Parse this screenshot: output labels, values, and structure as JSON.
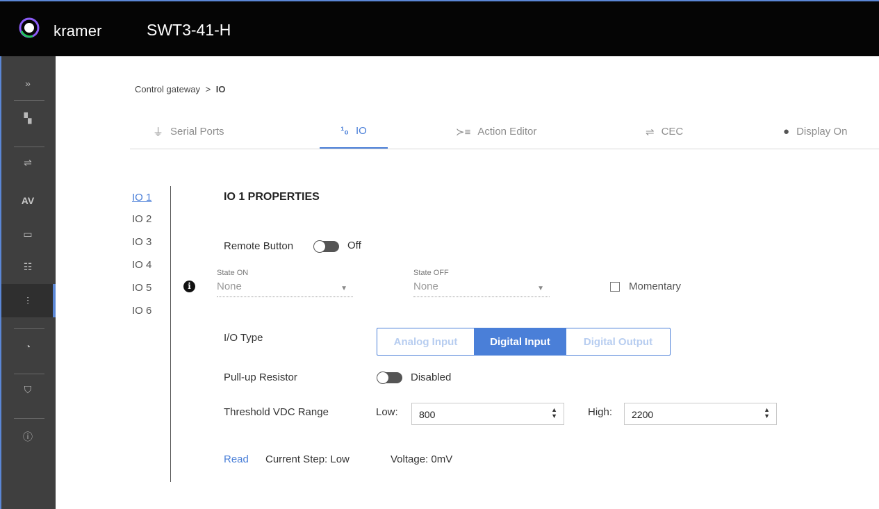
{
  "header": {
    "brand": "kramer",
    "model": "SWT3-41-H"
  },
  "sidebar": {
    "items": [
      {
        "icon": "expand-icon",
        "glyph": "»"
      },
      {
        "icon": "topology-icon",
        "glyph": "▚"
      },
      {
        "icon": "auto-switch-icon",
        "glyph": "⇌"
      },
      {
        "icon": "av-icon",
        "glyph": "AV"
      },
      {
        "icon": "edid-icon",
        "glyph": "▭"
      },
      {
        "icon": "settings-icon",
        "glyph": "☷"
      },
      {
        "icon": "control-gateway-icon",
        "glyph": "⫶"
      },
      {
        "icon": "diagnostics-icon",
        "glyph": "◔"
      },
      {
        "icon": "security-icon",
        "glyph": "⛉"
      },
      {
        "icon": "info-icon",
        "glyph": "ⓘ"
      }
    ]
  },
  "breadcrumb": {
    "parent": "Control gateway",
    "separator": ">",
    "current": "IO"
  },
  "tabs": [
    {
      "label": "Serial Ports",
      "icon": "serial-port-icon",
      "glyph": "⏚"
    },
    {
      "label": "IO",
      "icon": "io-icon",
      "glyph": "¹₀"
    },
    {
      "label": "Action Editor",
      "icon": "action-editor-icon",
      "glyph": "≻≡"
    },
    {
      "label": "CEC",
      "icon": "cec-icon",
      "glyph": "⇌"
    },
    {
      "label": "Display On",
      "icon": "display-on-icon",
      "glyph": "●"
    }
  ],
  "io_list": [
    "IO 1",
    "IO 2",
    "IO 3",
    "IO 4",
    "IO 5",
    "IO 6"
  ],
  "properties": {
    "title": "IO 1 PROPERTIES",
    "remote_button_label": "Remote Button",
    "remote_button_state": "Off",
    "state_on_label": "State ON",
    "state_on_value": "None",
    "state_off_label": "State OFF",
    "state_off_value": "None",
    "momentary_label": "Momentary",
    "io_type_label": "I/O Type",
    "io_types": [
      "Analog Input",
      "Digital Input",
      "Digital Output"
    ],
    "io_type_selected": "Digital Input",
    "pullup_label": "Pull-up Resistor",
    "pullup_state": "Disabled",
    "threshold_label": "Threshold VDC Range",
    "low_label": "Low:",
    "low_value": "800",
    "high_label": "High:",
    "high_value": "2200",
    "read_label": "Read",
    "current_step": "Current Step: Low",
    "voltage": "Voltage: 0mV"
  },
  "colors": {
    "accent": "#4a7fd8",
    "topbar": "#050505",
    "sidebar": "#3f3f3f"
  }
}
